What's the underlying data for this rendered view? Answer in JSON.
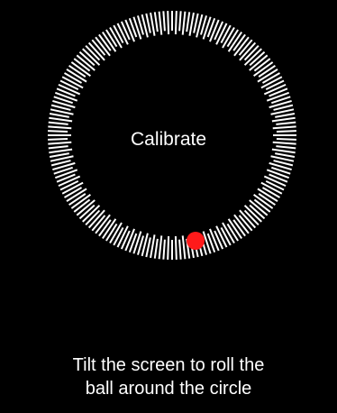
{
  "app": {
    "screen": "compass-calibration"
  },
  "calibration": {
    "title": "Calibrate",
    "instruction_line_1": "Tilt the screen to roll the",
    "instruction_line_2": "ball around the circle",
    "progress": 0,
    "ball_angle_degrees": 108,
    "colors": {
      "background": "#000000",
      "ticks": "#ffffff",
      "ball": "#ff1a1a",
      "text": "#ffffff"
    }
  }
}
